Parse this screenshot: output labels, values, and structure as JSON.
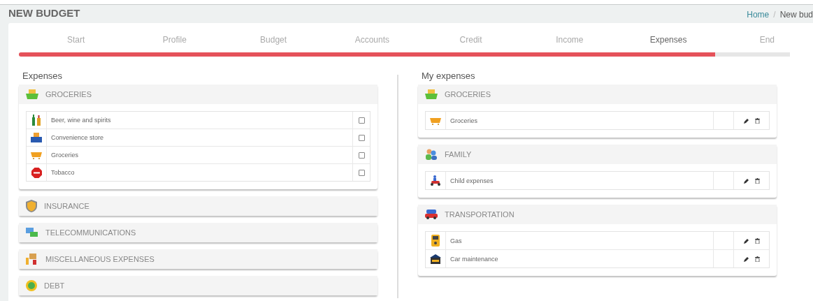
{
  "page_title": "NEW BUDGET",
  "breadcrumb": [
    {
      "label": "Home",
      "kind": "link"
    },
    {
      "label": "/",
      "kind": "separator"
    },
    {
      "label": "New bud",
      "kind": "current"
    }
  ],
  "steps": [
    {
      "label": "Start",
      "selected": false
    },
    {
      "label": "Profile",
      "selected": false
    },
    {
      "label": "Budget",
      "selected": false
    },
    {
      "label": "Accounts",
      "selected": false
    },
    {
      "label": "Credit",
      "selected": false
    },
    {
      "label": "Income",
      "selected": false
    },
    {
      "label": "Expenses",
      "selected": true
    },
    {
      "label": "End",
      "selected": false
    }
  ],
  "progress": {
    "level": 0.903
  },
  "expenses": {
    "title": "Expenses",
    "categories": [
      {
        "name": "GROCERIES",
        "items": [
          {
            "name": "Beer, wine and spirits",
            "checked": false
          },
          {
            "name": "Convenience store",
            "checked": false
          },
          {
            "name": "Groceries",
            "checked": false
          },
          {
            "name": "Tobacco",
            "checked": false
          }
        ]
      },
      {
        "name": "INSURANCE"
      },
      {
        "name": "TELECOMMUNICATIONS"
      },
      {
        "name": "MISCELLANEOUS EXPENSES"
      },
      {
        "name": "DEBT"
      }
    ]
  },
  "my_expenses": {
    "title": "My expenses",
    "categories": [
      {
        "name": "GROCERIES",
        "items": [
          {
            "name": "Groceries"
          }
        ]
      },
      {
        "name": "FAMILY",
        "items": [
          {
            "name": "Child expenses"
          }
        ]
      },
      {
        "name": "TRANSPORTATION",
        "items": [
          {
            "name": "Gas"
          },
          {
            "name": "Car maintenance"
          }
        ]
      }
    ]
  }
}
